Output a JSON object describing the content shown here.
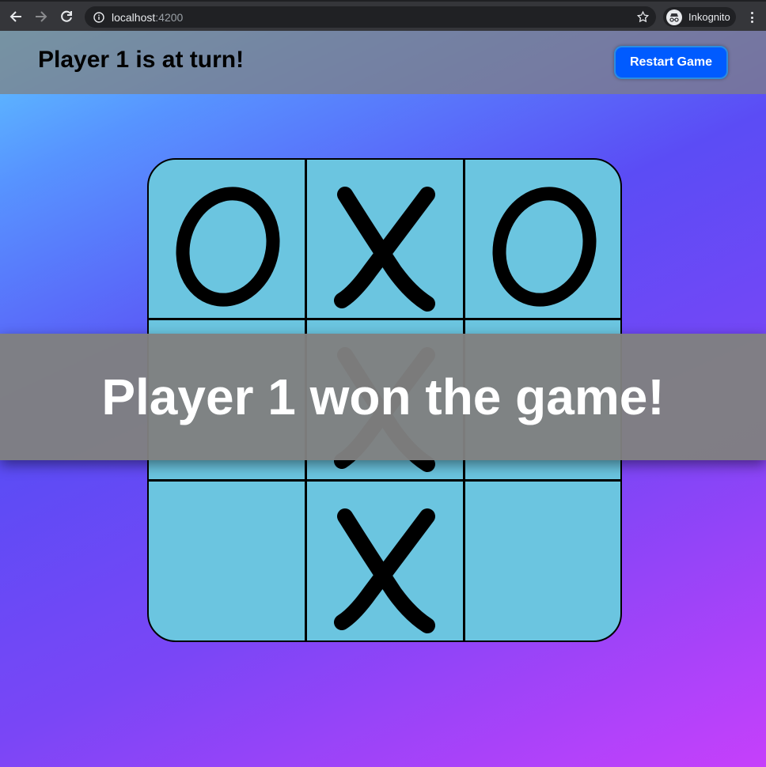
{
  "browser": {
    "url_host": "localhost",
    "url_port": ":4200",
    "profile_label": "Inkognito"
  },
  "header": {
    "turn_text": "Player 1 is at turn!",
    "restart_label": "Restart Game"
  },
  "board": {
    "cells": [
      "O",
      "X",
      "O",
      "",
      "X",
      "",
      "",
      "X",
      ""
    ]
  },
  "overlay": {
    "message": "Player 1 won the game!"
  },
  "colors": {
    "board_fill": "#6bc5e0",
    "restart_button": "#005bff",
    "header_bar": "#808080"
  }
}
